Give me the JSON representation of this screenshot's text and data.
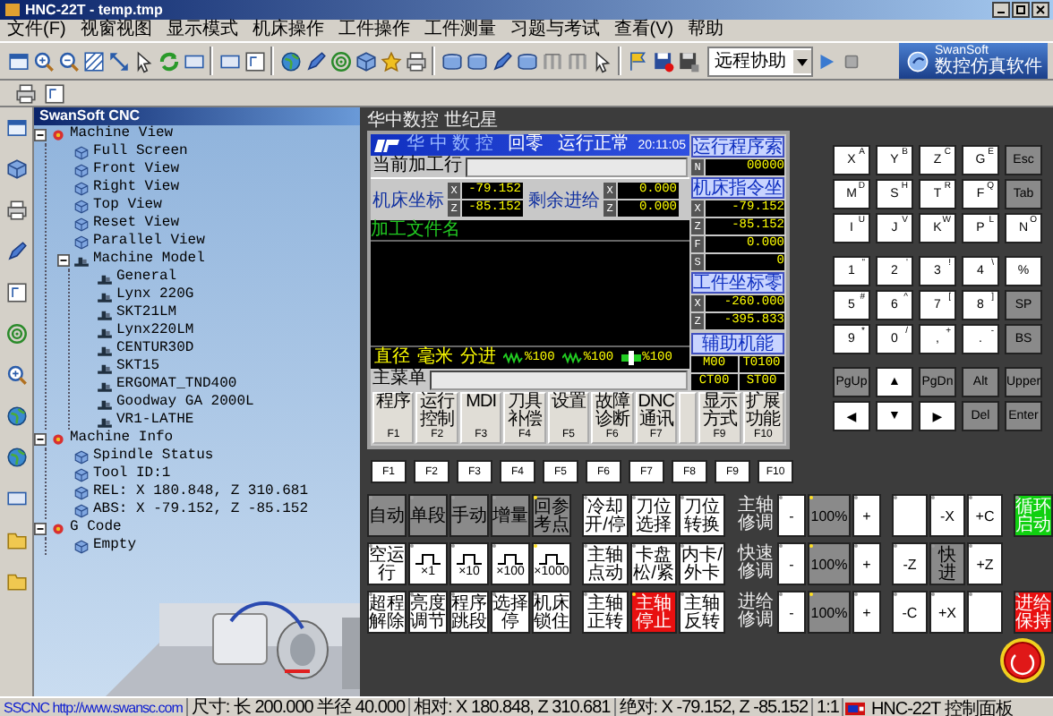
{
  "window": {
    "title": "HNC-22T - temp.tmp"
  },
  "menu": [
    "文件(F)",
    "视窗视图",
    "显示模式",
    "机床操作",
    "工件操作",
    "工件测量",
    "习题与考试",
    "查看(V)",
    "帮助"
  ],
  "toolbar": {
    "dropdown": "远程协助",
    "logo": {
      "name": "SwanSoft",
      "subtitle": "数控仿真软件"
    }
  },
  "tree": {
    "title": "SwanSoft CNC",
    "items": [
      {
        "label": "Machine View",
        "expanded": true,
        "children": [
          {
            "label": "Full Screen"
          },
          {
            "label": "Front View"
          },
          {
            "label": "Right View"
          },
          {
            "label": "Top View"
          },
          {
            "label": "Reset View"
          },
          {
            "label": "Parallel View"
          },
          {
            "label": "Machine Model",
            "expanded": true,
            "children": [
              {
                "label": "General"
              },
              {
                "label": "Lynx 220G"
              },
              {
                "label": "SKT21LM"
              },
              {
                "label": "Lynx220LM"
              },
              {
                "label": "CENTUR30D"
              },
              {
                "label": "SKT15"
              },
              {
                "label": "ERGOMAT_TND400"
              },
              {
                "label": "Goodway GA 2000L"
              },
              {
                "label": "VR1-LATHE"
              }
            ]
          }
        ]
      },
      {
        "label": "Machine Info",
        "expanded": true,
        "children": [
          {
            "label": "Spindle Status"
          },
          {
            "label": "Tool ID:1"
          },
          {
            "label": "REL: X 180.848, Z 310.681"
          },
          {
            "label": "ABS: X -79.152, Z -85.152"
          }
        ]
      },
      {
        "label": "G Code",
        "expanded": true,
        "children": [
          {
            "label": "Empty"
          }
        ]
      }
    ]
  },
  "panel": {
    "brand": "华中数控 世纪星",
    "screen": {
      "header": {
        "brand": "华 中 数 控",
        "mode": "回零",
        "status": "运行正常",
        "time": "20:11:05"
      },
      "current_line_label": "当前加工行",
      "coord_groups": [
        {
          "label": "机床坐标",
          "rows": [
            {
              "axis": "X",
              "value": "-79.152"
            },
            {
              "axis": "Z",
              "value": "-85.152"
            }
          ]
        },
        {
          "label": "剩余进给",
          "rows": [
            {
              "axis": "X",
              "value": "0.000"
            },
            {
              "axis": "Z",
              "value": "0.000"
            }
          ]
        }
      ],
      "file_label": "加工文件名",
      "modes": [
        "直径",
        "毫米",
        "分进"
      ],
      "overrides": [
        "%100",
        "%100",
        "%100"
      ],
      "menu_label": "主菜单",
      "softkeys": [
        {
          "kind": "key",
          "label": "程序",
          "key": "F1"
        },
        {
          "kind": "key",
          "label": "运行控制",
          "key": "F2"
        },
        {
          "kind": "key",
          "label": "MDI",
          "key": "F3"
        },
        {
          "kind": "key",
          "label": "刀具补偿",
          "key": "F4"
        },
        {
          "kind": "key",
          "label": "设置",
          "key": "F5"
        },
        {
          "kind": "key",
          "label": "故障诊断",
          "key": "F6"
        },
        {
          "kind": "key",
          "label": "DNC通讯",
          "key": "F7"
        },
        {
          "kind": "blank"
        },
        {
          "kind": "key",
          "label": "显示方式",
          "key": "F9"
        },
        {
          "kind": "key",
          "label": "扩展功能",
          "key": "F10"
        }
      ],
      "side_groups": [
        {
          "title": "运行程序索",
          "rows": [
            {
              "axis": "N",
              "value": "00000"
            }
          ]
        },
        {
          "title": "机床指令坐",
          "rows": [
            {
              "axis": "X",
              "value": "-79.152"
            },
            {
              "axis": "Z",
              "value": "-85.152"
            },
            {
              "axis": "F",
              "value": "0.000"
            },
            {
              "axis": "S",
              "value": "0"
            }
          ]
        },
        {
          "title": "工件坐标零",
          "rows": [
            {
              "axis": "X",
              "value": "-260.000"
            },
            {
              "axis": "Z",
              "value": "-395.833"
            }
          ]
        }
      ],
      "aux": {
        "title": "辅助机能",
        "cells": [
          "M00",
          "T0100",
          "CT00",
          "ST00"
        ]
      }
    },
    "keypad": [
      [
        {
          "label": "X",
          "sub": "A",
          "kind": "white"
        },
        {
          "label": "Y",
          "sub": "B",
          "kind": "white"
        },
        {
          "label": "Z",
          "sub": "C",
          "kind": "white"
        },
        {
          "label": "G",
          "sub": "E",
          "kind": "white"
        },
        {
          "label": "Esc",
          "kind": "grey"
        }
      ],
      [
        {
          "label": "M",
          "sub": "D",
          "kind": "white"
        },
        {
          "label": "S",
          "sub": "H",
          "kind": "white"
        },
        {
          "label": "T",
          "sub": "R",
          "kind": "white"
        },
        {
          "label": "F",
          "sub": "Q",
          "kind": "white"
        },
        {
          "label": "Tab",
          "kind": "grey"
        }
      ],
      [
        {
          "label": "I",
          "sub": "U",
          "kind": "white"
        },
        {
          "label": "J",
          "sub": "V",
          "kind": "white"
        },
        {
          "label": "K",
          "sub": "W",
          "kind": "white"
        },
        {
          "label": "P",
          "sub": "L",
          "kind": "white"
        },
        {
          "label": "N",
          "sub": "O",
          "kind": "white"
        }
      ],
      [
        {
          "label": "1",
          "sub": "\"",
          "kind": "white"
        },
        {
          "label": "2",
          "sub": "'",
          "kind": "white"
        },
        {
          "label": "3",
          "sub": "!",
          "kind": "white"
        },
        {
          "label": "4",
          "sub": "\\",
          "kind": "white"
        },
        {
          "label": "%",
          "kind": "white"
        }
      ],
      [
        {
          "label": "5",
          "sub": "#",
          "kind": "white"
        },
        {
          "label": "6",
          "sub": "^",
          "kind": "white"
        },
        {
          "label": "7",
          "sub": "[",
          "kind": "white"
        },
        {
          "label": "8",
          "sub": "]",
          "kind": "white"
        },
        {
          "label": "SP",
          "kind": "grey"
        }
      ],
      [
        {
          "label": "9",
          "sub": "*",
          "kind": "white"
        },
        {
          "label": "0",
          "sub": "/",
          "kind": "white"
        },
        {
          "label": ",",
          "sub": "+",
          "kind": "white"
        },
        {
          "label": ".",
          "sub": "-",
          "kind": "white"
        },
        {
          "label": "BS",
          "kind": "grey"
        }
      ],
      [
        {
          "label": "PgUp",
          "kind": "grey"
        },
        {
          "label": "▲",
          "kind": "white"
        },
        {
          "label": "PgDn",
          "kind": "grey"
        },
        {
          "label": "Alt",
          "kind": "grey"
        },
        {
          "label": "Upper",
          "kind": "grey"
        }
      ],
      [
        {
          "label": "◀",
          "kind": "white"
        },
        {
          "label": "▼",
          "kind": "white"
        },
        {
          "label": "▶",
          "kind": "white"
        },
        {
          "label": "Del",
          "kind": "grey"
        },
        {
          "label": "Enter",
          "kind": "grey"
        }
      ]
    ],
    "function_keys": [
      "F1",
      "F2",
      "F3",
      "F4",
      "F5",
      "F6",
      "F7",
      "F8",
      "F9",
      "F10"
    ],
    "op_rows": [
      {
        "keys": [
          {
            "kind": "grey",
            "label": "自动",
            "lit": false
          },
          {
            "kind": "grey",
            "label": "单段",
            "lit": false
          },
          {
            "kind": "grey",
            "label": "手动",
            "lit": false
          },
          {
            "kind": "grey",
            "label": "增量",
            "lit": false
          },
          {
            "kind": "grey",
            "label": "回参考点",
            "lit": true
          },
          {
            "kind": "white",
            "label": "冷却开/停",
            "lit": false
          },
          {
            "kind": "white",
            "label": "刀位选择",
            "lit": false
          },
          {
            "kind": "white",
            "label": "刀位转换",
            "lit": false
          },
          {
            "kind": "label",
            "label": "主轴修调"
          },
          {
            "kind": "white",
            "label": "-",
            "lit": false
          },
          {
            "kind": "grey",
            "label": "100%",
            "lit": true
          },
          {
            "kind": "white",
            "label": "+",
            "lit": false
          },
          {
            "kind": "blank",
            "lit": false
          },
          {
            "kind": "white",
            "label": "-X",
            "lit": false
          },
          {
            "kind": "white",
            "label": "+C",
            "lit": false
          },
          {
            "kind": "green",
            "label": "循环启动",
            "lit": false
          }
        ]
      },
      {
        "keys": [
          {
            "kind": "white",
            "label": "空运行",
            "lit": false
          },
          {
            "kind": "pulse",
            "label": "×1",
            "lit": false
          },
          {
            "kind": "pulse",
            "label": "×10",
            "lit": false
          },
          {
            "kind": "pulse",
            "label": "×100",
            "lit": false
          },
          {
            "kind": "pulse",
            "label": "×1000",
            "lit": true
          },
          {
            "kind": "white",
            "label": "主轴点动",
            "lit": false
          },
          {
            "kind": "white",
            "label": "卡盘松/紧",
            "lit": false
          },
          {
            "kind": "white",
            "label": "内卡/外卡",
            "lit": false
          },
          {
            "kind": "label",
            "label": "快速修调"
          },
          {
            "kind": "white",
            "label": "-",
            "lit": false
          },
          {
            "kind": "grey",
            "label": "100%",
            "lit": true
          },
          {
            "kind": "white",
            "label": "+",
            "lit": false
          },
          {
            "kind": "white",
            "label": "-Z",
            "lit": false
          },
          {
            "kind": "grey",
            "label": "快进",
            "lit": false
          },
          {
            "kind": "white",
            "label": "+Z",
            "lit": false
          }
        ]
      },
      {
        "keys": [
          {
            "kind": "white",
            "label": "超程解除",
            "lit": false
          },
          {
            "kind": "white",
            "label": "亮度调节",
            "lit": false
          },
          {
            "kind": "white",
            "label": "程序跳段",
            "lit": false
          },
          {
            "kind": "white",
            "label": "选择停",
            "lit": false
          },
          {
            "kind": "white",
            "label": "机床锁住",
            "lit": false
          },
          {
            "kind": "white",
            "label": "主轴正转",
            "lit": false
          },
          {
            "kind": "red",
            "label": "主轴停止",
            "lit": true
          },
          {
            "kind": "white",
            "label": "主轴反转",
            "lit": false
          },
          {
            "kind": "label",
            "label": "进给修调"
          },
          {
            "kind": "white",
            "label": "-",
            "lit": false
          },
          {
            "kind": "grey",
            "label": "100%",
            "lit": true
          },
          {
            "kind": "white",
            "label": "+",
            "lit": false
          },
          {
            "kind": "white",
            "label": "-C",
            "lit": false
          },
          {
            "kind": "white",
            "label": "+X",
            "lit": false
          },
          {
            "kind": "blank",
            "lit": false
          },
          {
            "kind": "red",
            "label": "进给保持",
            "lit": false
          }
        ]
      }
    ]
  },
  "status_bar": [
    {
      "kind": "link",
      "text": "SSCNC http://www.swansc.com"
    },
    {
      "kind": "text",
      "text": "尺寸: 长 200.000 半径 40.000"
    },
    {
      "kind": "text",
      "text": "相对: X 180.848, Z 310.681"
    },
    {
      "kind": "text",
      "text": "绝对: X -79.152, Z -85.152"
    },
    {
      "kind": "text",
      "text": "1:1"
    },
    {
      "kind": "panel",
      "text": "HNC-22T 控制面板"
    }
  ]
}
